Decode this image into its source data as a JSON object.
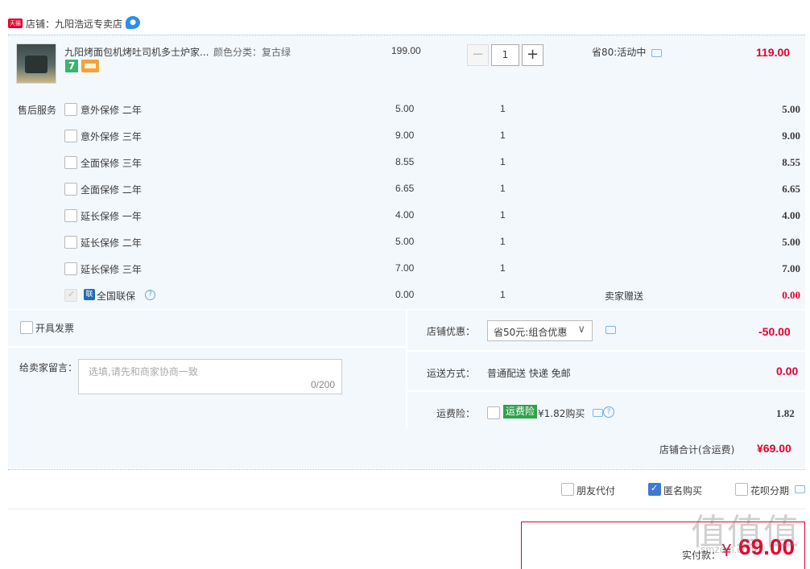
{
  "shop": {
    "badge": "天猫",
    "name": "店铺：九阳浩远专卖店"
  },
  "product": {
    "title": "九阳烤面包机烤吐司机多士炉家...",
    "sku": "颜色分类：复古绿",
    "badge_seven": "7",
    "price": "199.00",
    "quantity": "1",
    "qty_minus": "−",
    "qty_plus": "+",
    "promo": "省80:活动中",
    "total": "119.00"
  },
  "services": {
    "label": "售后服务",
    "items": [
      {
        "name": "意外保修 二年",
        "price": "5.00",
        "qty": "1",
        "total": "5.00"
      },
      {
        "name": "意外保修 三年",
        "price": "9.00",
        "qty": "1",
        "total": "9.00"
      },
      {
        "name": "全面保修 三年",
        "price": "8.55",
        "qty": "1",
        "total": "8.55"
      },
      {
        "name": "全面保修 二年",
        "price": "6.65",
        "qty": "1",
        "total": "6.65"
      },
      {
        "name": "延长保修 一年",
        "price": "4.00",
        "qty": "1",
        "total": "4.00"
      },
      {
        "name": "延长保修 二年",
        "price": "5.00",
        "qty": "1",
        "total": "5.00"
      },
      {
        "name": "延长保修 三年",
        "price": "7.00",
        "qty": "1",
        "total": "7.00"
      }
    ],
    "joint": {
      "icon": "联",
      "name": "全国联保",
      "price": "0.00",
      "qty": "1",
      "gift": "卖家赠送",
      "total": "0.00"
    }
  },
  "options": {
    "invoice_label": "开具发票",
    "message_label": "给卖家留言：",
    "message_placeholder": "选填,请先和商家协商一致",
    "message_count": "0/200",
    "coupon_label": "店铺优惠：",
    "coupon_value": "省50元:组合优惠",
    "coupon_amount": "-50.00",
    "shipping_label": "运送方式：",
    "shipping_value": "普通配送 快递 免邮",
    "shipping_amount": "0.00",
    "insurance_label": "运费险：",
    "insurance_tag": "运费险",
    "insurance_price": "¥1.82购买",
    "insurance_amount": "1.82"
  },
  "subtotal": {
    "label": "店铺合计(含运费)",
    "value": "¥69.00"
  },
  "checkout": {
    "friend_pay": "朋友代付",
    "anonymous": "匿名购买",
    "anonymous_checked": true,
    "huabei": "花呗分期"
  },
  "pay": {
    "label": "实付款：",
    "currency": "¥",
    "amount": "69.00"
  },
  "watermark": {
    "text": "值值值",
    "sub": "smzdm.com"
  },
  "colors": {
    "accent_red": "#e4002b",
    "panel_bg": "#f3f8fd",
    "checkbox_blue": "#3d7ad6",
    "insurance_green": "#2fa24a"
  }
}
